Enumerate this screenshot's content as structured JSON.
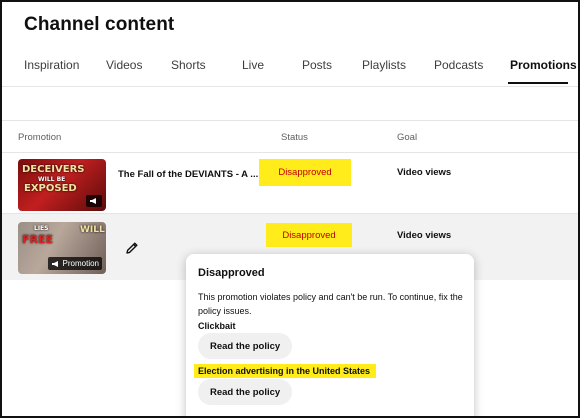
{
  "header": {
    "title": "Channel content"
  },
  "tabs": [
    {
      "label": "Inspiration"
    },
    {
      "label": "Videos"
    },
    {
      "label": "Shorts"
    },
    {
      "label": "Live"
    },
    {
      "label": "Posts"
    },
    {
      "label": "Playlists"
    },
    {
      "label": "Podcasts"
    },
    {
      "label": "Promotions",
      "active": true
    }
  ],
  "table": {
    "columns": {
      "promotion": "Promotion",
      "status": "Status",
      "goal": "Goal"
    },
    "rows": [
      {
        "title": "The Fall of the DEVIANTS - A ...",
        "status": "Disapproved",
        "goal": "Video views",
        "thumbnail_text": [
          "DECEIVERS",
          "WILL BE",
          "EXPOSED"
        ]
      },
      {
        "title": "",
        "status": "Disapproved",
        "goal": "Video views",
        "thumbnail_text": [
          "LIES",
          "FREE",
          "WILL"
        ],
        "badge": "Promotion"
      }
    ]
  },
  "popup": {
    "title": "Disapproved",
    "body": "This promotion violates policy and can't be run. To continue, fix the policy issues.",
    "reasons": [
      {
        "label": "Clickbait",
        "button": "Read the policy"
      },
      {
        "label": "Election advertising in the United States",
        "button": "Read the policy"
      }
    ]
  },
  "colors": {
    "highlight": "#ffec1a",
    "status_text": "#c00000",
    "active_tab": "#0f0f0f"
  },
  "icons": {
    "edit": "pencil-icon",
    "promotion_badge": "megaphone-icon"
  }
}
